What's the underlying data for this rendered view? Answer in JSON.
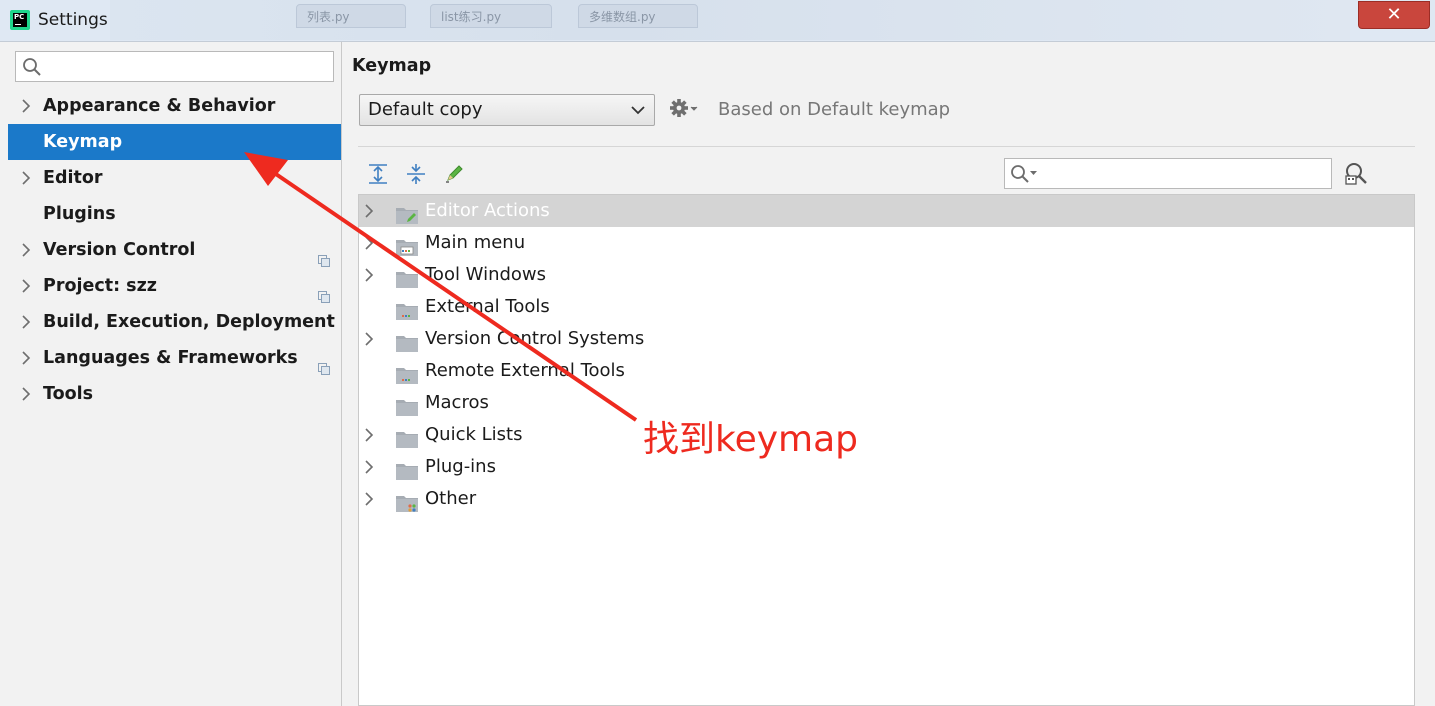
{
  "window": {
    "title": "Settings",
    "close_glyph": "✕",
    "background_tabs": [
      "列表.py",
      "list练习.py",
      "多维数组.py"
    ]
  },
  "sidebar": {
    "search": {
      "value": "",
      "placeholder": ""
    },
    "items": [
      {
        "label": "Appearance & Behavior",
        "expandable": true,
        "selected": false,
        "project_scoped": false
      },
      {
        "label": "Keymap",
        "expandable": false,
        "selected": true,
        "project_scoped": false
      },
      {
        "label": "Editor",
        "expandable": true,
        "selected": false,
        "project_scoped": false
      },
      {
        "label": "Plugins",
        "expandable": false,
        "selected": false,
        "project_scoped": false
      },
      {
        "label": "Version Control",
        "expandable": true,
        "selected": false,
        "project_scoped": true
      },
      {
        "label": "Project: szz",
        "expandable": true,
        "selected": false,
        "project_scoped": true
      },
      {
        "label": "Build, Execution, Deployment",
        "expandable": true,
        "selected": false,
        "project_scoped": false
      },
      {
        "label": "Languages & Frameworks",
        "expandable": true,
        "selected": false,
        "project_scoped": true
      },
      {
        "label": "Tools",
        "expandable": true,
        "selected": false,
        "project_scoped": false
      }
    ]
  },
  "main": {
    "title": "Keymap",
    "keymap_select": {
      "value": "Default copy"
    },
    "based_on": "Based on Default keymap",
    "filter": {
      "value": "",
      "placeholder": ""
    },
    "tree": [
      {
        "label": "Editor Actions",
        "expandable": true,
        "selected": true,
        "icon": "folder-edit-icon"
      },
      {
        "label": "Main menu",
        "expandable": true,
        "selected": false,
        "icon": "folder-menu-icon"
      },
      {
        "label": "Tool Windows",
        "expandable": true,
        "selected": false,
        "icon": "folder-icon"
      },
      {
        "label": "External Tools",
        "expandable": false,
        "selected": false,
        "icon": "folder-tools-icon"
      },
      {
        "label": "Version Control Systems",
        "expandable": true,
        "selected": false,
        "icon": "folder-icon"
      },
      {
        "label": "Remote External Tools",
        "expandable": false,
        "selected": false,
        "icon": "folder-tools-icon"
      },
      {
        "label": "Macros",
        "expandable": false,
        "selected": false,
        "icon": "folder-icon"
      },
      {
        "label": "Quick Lists",
        "expandable": true,
        "selected": false,
        "icon": "folder-icon"
      },
      {
        "label": "Plug-ins",
        "expandable": true,
        "selected": false,
        "icon": "folder-icon"
      },
      {
        "label": "Other",
        "expandable": true,
        "selected": false,
        "icon": "folder-other-icon"
      }
    ]
  },
  "annotation": {
    "text": "找到keymap",
    "color": "#ee2a1f"
  },
  "colors": {
    "selection": "#1b79c9",
    "tree_selection": "#d4d4d4",
    "close_button": "#c9463d"
  }
}
